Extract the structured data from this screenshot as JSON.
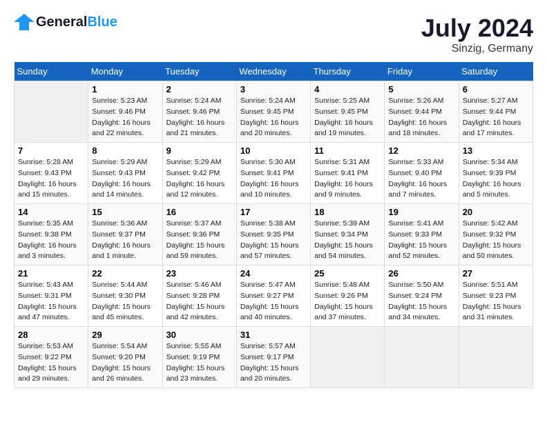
{
  "header": {
    "logo_line1": "General",
    "logo_line2": "Blue",
    "month_year": "July 2024",
    "location": "Sinzig, Germany"
  },
  "weekdays": [
    "Sunday",
    "Monday",
    "Tuesday",
    "Wednesday",
    "Thursday",
    "Friday",
    "Saturday"
  ],
  "weeks": [
    [
      {
        "day": "",
        "empty": true
      },
      {
        "day": "1",
        "sunrise": "Sunrise: 5:23 AM",
        "sunset": "Sunset: 9:46 PM",
        "daylight": "Daylight: 16 hours and 22 minutes."
      },
      {
        "day": "2",
        "sunrise": "Sunrise: 5:24 AM",
        "sunset": "Sunset: 9:46 PM",
        "daylight": "Daylight: 16 hours and 21 minutes."
      },
      {
        "day": "3",
        "sunrise": "Sunrise: 5:24 AM",
        "sunset": "Sunset: 9:45 PM",
        "daylight": "Daylight: 16 hours and 20 minutes."
      },
      {
        "day": "4",
        "sunrise": "Sunrise: 5:25 AM",
        "sunset": "Sunset: 9:45 PM",
        "daylight": "Daylight: 16 hours and 19 minutes."
      },
      {
        "day": "5",
        "sunrise": "Sunrise: 5:26 AM",
        "sunset": "Sunset: 9:44 PM",
        "daylight": "Daylight: 16 hours and 18 minutes."
      },
      {
        "day": "6",
        "sunrise": "Sunrise: 5:27 AM",
        "sunset": "Sunset: 9:44 PM",
        "daylight": "Daylight: 16 hours and 17 minutes."
      }
    ],
    [
      {
        "day": "7",
        "sunrise": "Sunrise: 5:28 AM",
        "sunset": "Sunset: 9:43 PM",
        "daylight": "Daylight: 16 hours and 15 minutes."
      },
      {
        "day": "8",
        "sunrise": "Sunrise: 5:29 AM",
        "sunset": "Sunset: 9:43 PM",
        "daylight": "Daylight: 16 hours and 14 minutes."
      },
      {
        "day": "9",
        "sunrise": "Sunrise: 5:29 AM",
        "sunset": "Sunset: 9:42 PM",
        "daylight": "Daylight: 16 hours and 12 minutes."
      },
      {
        "day": "10",
        "sunrise": "Sunrise: 5:30 AM",
        "sunset": "Sunset: 9:41 PM",
        "daylight": "Daylight: 16 hours and 10 minutes."
      },
      {
        "day": "11",
        "sunrise": "Sunrise: 5:31 AM",
        "sunset": "Sunset: 9:41 PM",
        "daylight": "Daylight: 16 hours and 9 minutes."
      },
      {
        "day": "12",
        "sunrise": "Sunrise: 5:33 AM",
        "sunset": "Sunset: 9:40 PM",
        "daylight": "Daylight: 16 hours and 7 minutes."
      },
      {
        "day": "13",
        "sunrise": "Sunrise: 5:34 AM",
        "sunset": "Sunset: 9:39 PM",
        "daylight": "Daylight: 16 hours and 5 minutes."
      }
    ],
    [
      {
        "day": "14",
        "sunrise": "Sunrise: 5:35 AM",
        "sunset": "Sunset: 9:38 PM",
        "daylight": "Daylight: 16 hours and 3 minutes."
      },
      {
        "day": "15",
        "sunrise": "Sunrise: 5:36 AM",
        "sunset": "Sunset: 9:37 PM",
        "daylight": "Daylight: 16 hours and 1 minute."
      },
      {
        "day": "16",
        "sunrise": "Sunrise: 5:37 AM",
        "sunset": "Sunset: 9:36 PM",
        "daylight": "Daylight: 15 hours and 59 minutes."
      },
      {
        "day": "17",
        "sunrise": "Sunrise: 5:38 AM",
        "sunset": "Sunset: 9:35 PM",
        "daylight": "Daylight: 15 hours and 57 minutes."
      },
      {
        "day": "18",
        "sunrise": "Sunrise: 5:39 AM",
        "sunset": "Sunset: 9:34 PM",
        "daylight": "Daylight: 15 hours and 54 minutes."
      },
      {
        "day": "19",
        "sunrise": "Sunrise: 5:41 AM",
        "sunset": "Sunset: 9:33 PM",
        "daylight": "Daylight: 15 hours and 52 minutes."
      },
      {
        "day": "20",
        "sunrise": "Sunrise: 5:42 AM",
        "sunset": "Sunset: 9:32 PM",
        "daylight": "Daylight: 15 hours and 50 minutes."
      }
    ],
    [
      {
        "day": "21",
        "sunrise": "Sunrise: 5:43 AM",
        "sunset": "Sunset: 9:31 PM",
        "daylight": "Daylight: 15 hours and 47 minutes."
      },
      {
        "day": "22",
        "sunrise": "Sunrise: 5:44 AM",
        "sunset": "Sunset: 9:30 PM",
        "daylight": "Daylight: 15 hours and 45 minutes."
      },
      {
        "day": "23",
        "sunrise": "Sunrise: 5:46 AM",
        "sunset": "Sunset: 9:28 PM",
        "daylight": "Daylight: 15 hours and 42 minutes."
      },
      {
        "day": "24",
        "sunrise": "Sunrise: 5:47 AM",
        "sunset": "Sunset: 9:27 PM",
        "daylight": "Daylight: 15 hours and 40 minutes."
      },
      {
        "day": "25",
        "sunrise": "Sunrise: 5:48 AM",
        "sunset": "Sunset: 9:26 PM",
        "daylight": "Daylight: 15 hours and 37 minutes."
      },
      {
        "day": "26",
        "sunrise": "Sunrise: 5:50 AM",
        "sunset": "Sunset: 9:24 PM",
        "daylight": "Daylight: 15 hours and 34 minutes."
      },
      {
        "day": "27",
        "sunrise": "Sunrise: 5:51 AM",
        "sunset": "Sunset: 9:23 PM",
        "daylight": "Daylight: 15 hours and 31 minutes."
      }
    ],
    [
      {
        "day": "28",
        "sunrise": "Sunrise: 5:53 AM",
        "sunset": "Sunset: 9:22 PM",
        "daylight": "Daylight: 15 hours and 29 minutes."
      },
      {
        "day": "29",
        "sunrise": "Sunrise: 5:54 AM",
        "sunset": "Sunset: 9:20 PM",
        "daylight": "Daylight: 15 hours and 26 minutes."
      },
      {
        "day": "30",
        "sunrise": "Sunrise: 5:55 AM",
        "sunset": "Sunset: 9:19 PM",
        "daylight": "Daylight: 15 hours and 23 minutes."
      },
      {
        "day": "31",
        "sunrise": "Sunrise: 5:57 AM",
        "sunset": "Sunset: 9:17 PM",
        "daylight": "Daylight: 15 hours and 20 minutes."
      },
      {
        "day": "",
        "empty": true
      },
      {
        "day": "",
        "empty": true
      },
      {
        "day": "",
        "empty": true
      }
    ]
  ]
}
